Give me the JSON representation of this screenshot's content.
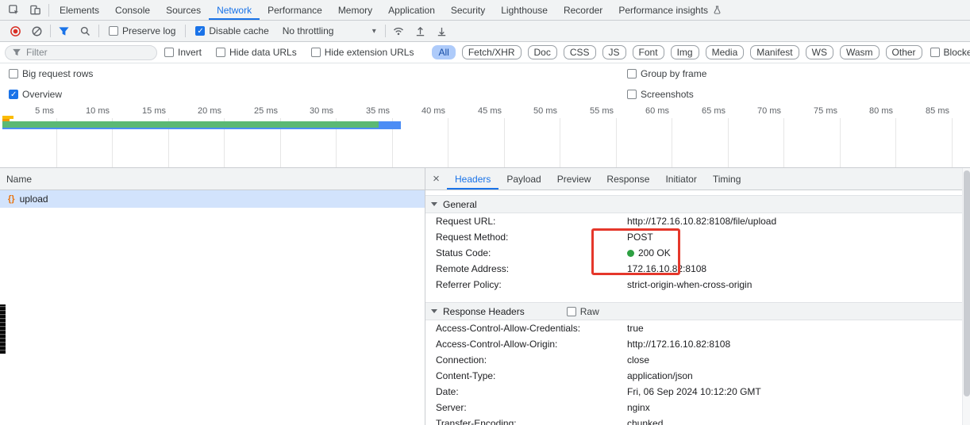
{
  "colors": {
    "accent": "#1a73e8",
    "status_green": "#2ea043",
    "annotation_red": "#e5372b",
    "bar_green": "#5bb974",
    "bar_blue": "#4c8df5",
    "bar_yellow": "#fbbc04",
    "bar_orange": "#f29900"
  },
  "tabbar": {
    "tabs": [
      "Elements",
      "Console",
      "Sources",
      "Network",
      "Performance",
      "Memory",
      "Application",
      "Security",
      "Lighthouse",
      "Recorder",
      "Performance insights"
    ],
    "active": "Network"
  },
  "toolbar": {
    "preserve_log": "Preserve log",
    "disable_cache": "Disable cache",
    "throttling": "No throttling",
    "caret": "▾"
  },
  "filter": {
    "placeholder": "Filter",
    "invert": "Invert",
    "hide_data_urls": "Hide data URLs",
    "hide_extension_urls": "Hide extension URLs",
    "chips": [
      "All",
      "Fetch/XHR",
      "Doc",
      "CSS",
      "JS",
      "Font",
      "Img",
      "Media",
      "Manifest",
      "WS",
      "Wasm",
      "Other"
    ],
    "active_chip": "All",
    "blocked_cookies": "Blocked response coo"
  },
  "options": {
    "big_request_rows": "Big request rows",
    "group_by_frame": "Group by frame",
    "overview": "Overview",
    "screenshots": "Screenshots"
  },
  "timeline": {
    "ticks": [
      "5 ms",
      "10 ms",
      "15 ms",
      "20 ms",
      "25 ms",
      "30 ms",
      "35 ms",
      "40 ms",
      "45 ms",
      "50 ms",
      "55 ms",
      "60 ms",
      "65 ms",
      "70 ms",
      "75 ms",
      "80 ms",
      "85 ms"
    ]
  },
  "requests": {
    "name_header": "Name",
    "rows": [
      {
        "icon": "{}",
        "name": "upload"
      }
    ]
  },
  "details": {
    "close_icon": "×",
    "tabs": [
      "Headers",
      "Payload",
      "Preview",
      "Response",
      "Initiator",
      "Timing"
    ],
    "active_tab": "Headers",
    "general": {
      "title": "General",
      "fields": [
        {
          "label": "Request URL:",
          "value": "http://172.16.10.82:8108/file/upload"
        },
        {
          "label": "Request Method:",
          "value": "POST"
        },
        {
          "label": "Status Code:",
          "value": "200 OK"
        },
        {
          "label": "Remote Address:",
          "value": "172.16.10.82:8108"
        },
        {
          "label": "Referrer Policy:",
          "value": "strict-origin-when-cross-origin"
        }
      ]
    },
    "response_headers": {
      "title": "Response Headers",
      "raw_label": "Raw",
      "fields": [
        {
          "label": "Access-Control-Allow-Credentials:",
          "value": "true"
        },
        {
          "label": "Access-Control-Allow-Origin:",
          "value": "http://172.16.10.82:8108"
        },
        {
          "label": "Connection:",
          "value": "close"
        },
        {
          "label": "Content-Type:",
          "value": "application/json"
        },
        {
          "label": "Date:",
          "value": "Fri, 06 Sep 2024 10:12:20 GMT"
        },
        {
          "label": "Server:",
          "value": "nginx"
        },
        {
          "label": "Transfer-Encoding:",
          "value": "chunked"
        }
      ]
    }
  }
}
